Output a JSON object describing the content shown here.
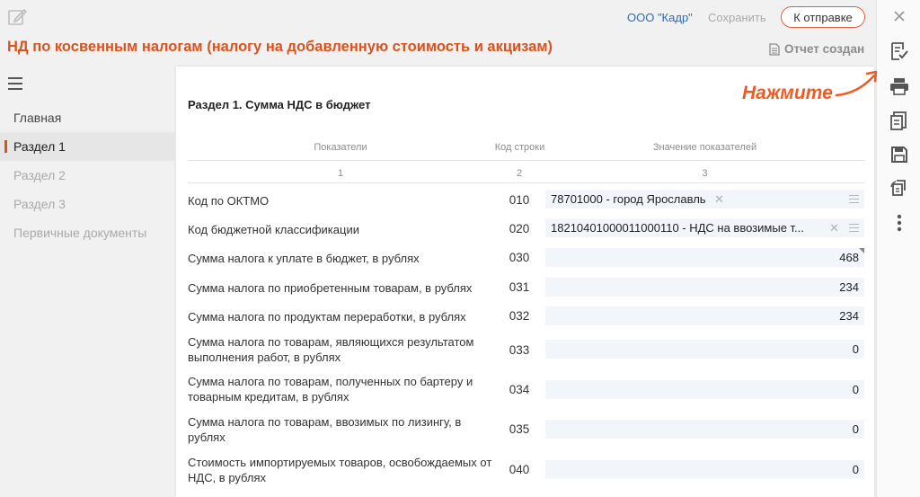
{
  "header": {
    "org_name": "ООО \"Кадр\"",
    "save_label": "Сохранить",
    "send_label": "К отправке",
    "title": "НД по косвенным налогам (налогу на добавленную стоимость и акцизам)",
    "report_status": "Отчет создан"
  },
  "nav": {
    "items": [
      {
        "label": "Главная"
      },
      {
        "label": "Раздел 1"
      },
      {
        "label": "Раздел 2"
      },
      {
        "label": "Раздел 3"
      },
      {
        "label": "Первичные документы"
      }
    ]
  },
  "section": {
    "title": "Раздел 1. Сумма НДС в бюджет",
    "columns": {
      "indicators": "Показатели",
      "line_code": "Код строки",
      "values": "Значение показателей",
      "num1": "1",
      "num2": "2",
      "num3": "3"
    },
    "rows": [
      {
        "label": "Код по ОКТМО",
        "code": "010",
        "value": "78701000 - город Ярославль"
      },
      {
        "label": "Код бюджетной классификации",
        "code": "020",
        "value": "18210401000011000110 - НДС на ввозимые т..."
      },
      {
        "label": "Сумма налога к уплате в бюджет, в рублях",
        "code": "030",
        "value": "468"
      },
      {
        "label": "Сумма налога по приобретенным товарам, в рублях",
        "code": "031",
        "value": "234"
      },
      {
        "label": "Сумма налога по продуктам переработки, в рублях",
        "code": "032",
        "value": "234"
      },
      {
        "label": "Сумма налога по товарам, являющихся результатом выполнения работ, в рублях",
        "code": "033",
        "value": "0"
      },
      {
        "label": "Сумма налога по товарам, полученных по бартеру и товарным кредитам, в рублях",
        "code": "034",
        "value": "0"
      },
      {
        "label": "Сумма налога по товарам, ввозимых по лизингу, в рублях",
        "code": "035",
        "value": "0"
      },
      {
        "label": "Стоимость импортируемых товаров, освобождаемых от НДС, в рублях",
        "code": "040",
        "value": "0"
      }
    ]
  },
  "annotation": {
    "hint": "Нажмите"
  },
  "colors": {
    "accent": "#d9531e",
    "link": "#2a6ebb",
    "hint": "#f15a22"
  }
}
